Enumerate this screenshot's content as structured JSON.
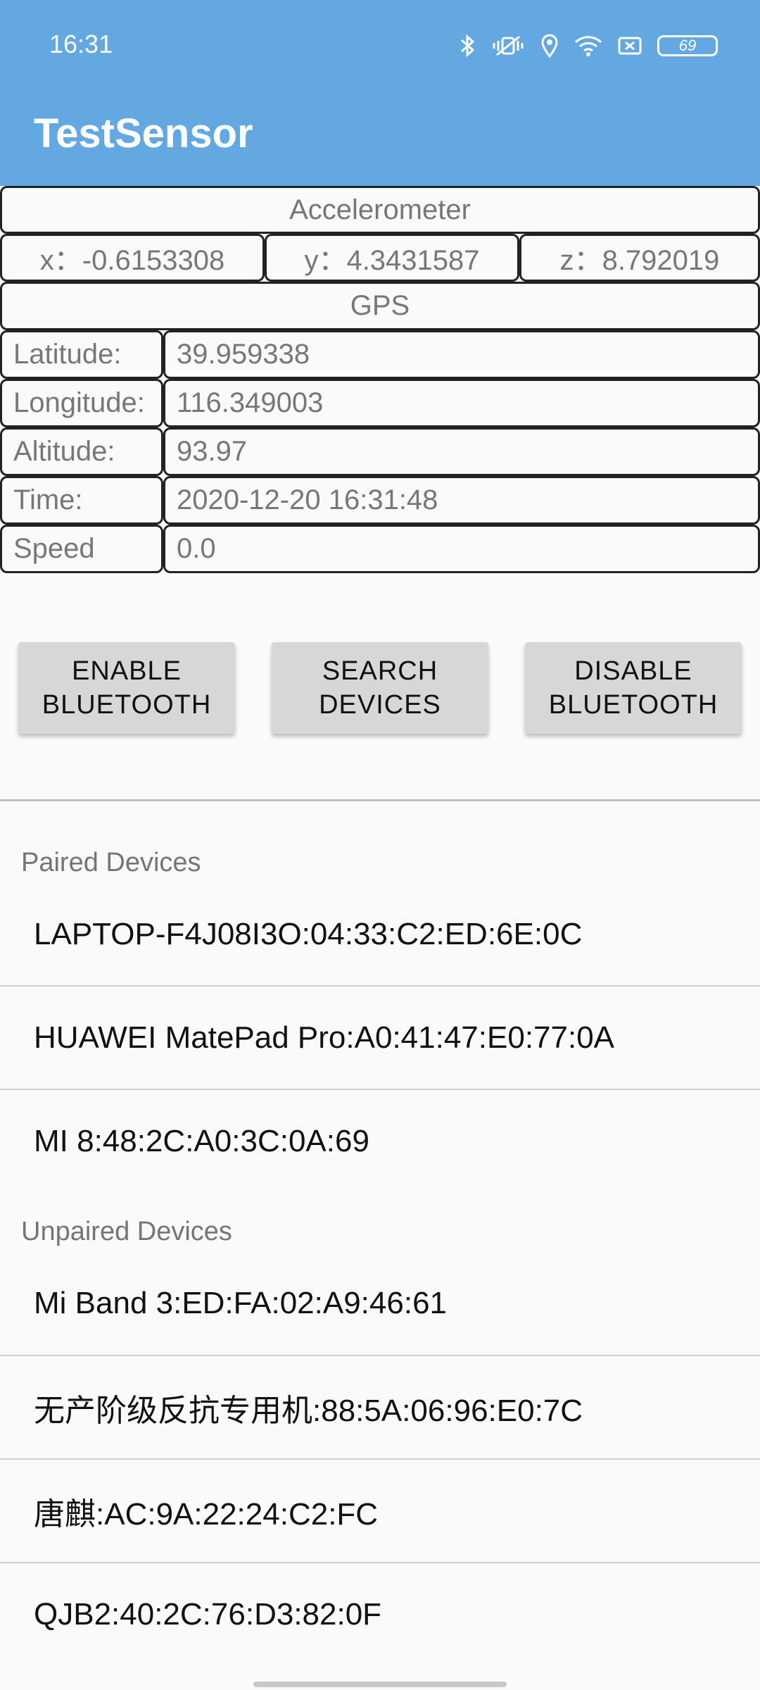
{
  "status_bar": {
    "time": "16:31",
    "battery_level": "69",
    "icons": [
      "bluetooth-icon",
      "vibrate-icon",
      "location-icon",
      "wifi-icon",
      "sim-icon",
      "battery-icon"
    ]
  },
  "app": {
    "title": "TestSensor"
  },
  "accelerometer": {
    "title": "Accelerometer",
    "x": "x：-0.6153308",
    "y": "y：4.3431587",
    "z": "z：8.792019"
  },
  "gps": {
    "title": "GPS",
    "rows": [
      {
        "label": "Latitude:",
        "value": "39.959338"
      },
      {
        "label": "Longitude:",
        "value": "116.349003"
      },
      {
        "label": "Altitude:",
        "value": "93.97"
      },
      {
        "label": "Time:",
        "value": "2020-12-20 16:31:48"
      },
      {
        "label": "Speed",
        "value": "0.0"
      }
    ]
  },
  "buttons": {
    "enable": "ENABLE\nBLUETOOTH",
    "search": "SEARCH\nDEVICES",
    "disable": "DISABLE\nBLUETOOTH"
  },
  "paired": {
    "header": "Paired Devices",
    "items": [
      "LAPTOP-F4J08I3O:04:33:C2:ED:6E:0C",
      "HUAWEI MatePad Pro:A0:41:47:E0:77:0A",
      "MI 8:48:2C:A0:3C:0A:69"
    ]
  },
  "unpaired": {
    "header": "Unpaired Devices",
    "items": [
      "Mi Band 3:ED:FA:02:A9:46:61",
      "无产阶级反抗专用机:88:5A:06:96:E0:7C",
      "唐麒:AC:9A:22:24:C2:FC",
      "QJB2:40:2C:76:D3:82:0F"
    ]
  },
  "colors": {
    "app_bar": "#64A8E2",
    "background": "#FAFAFA",
    "button": "#D7D7D7"
  }
}
